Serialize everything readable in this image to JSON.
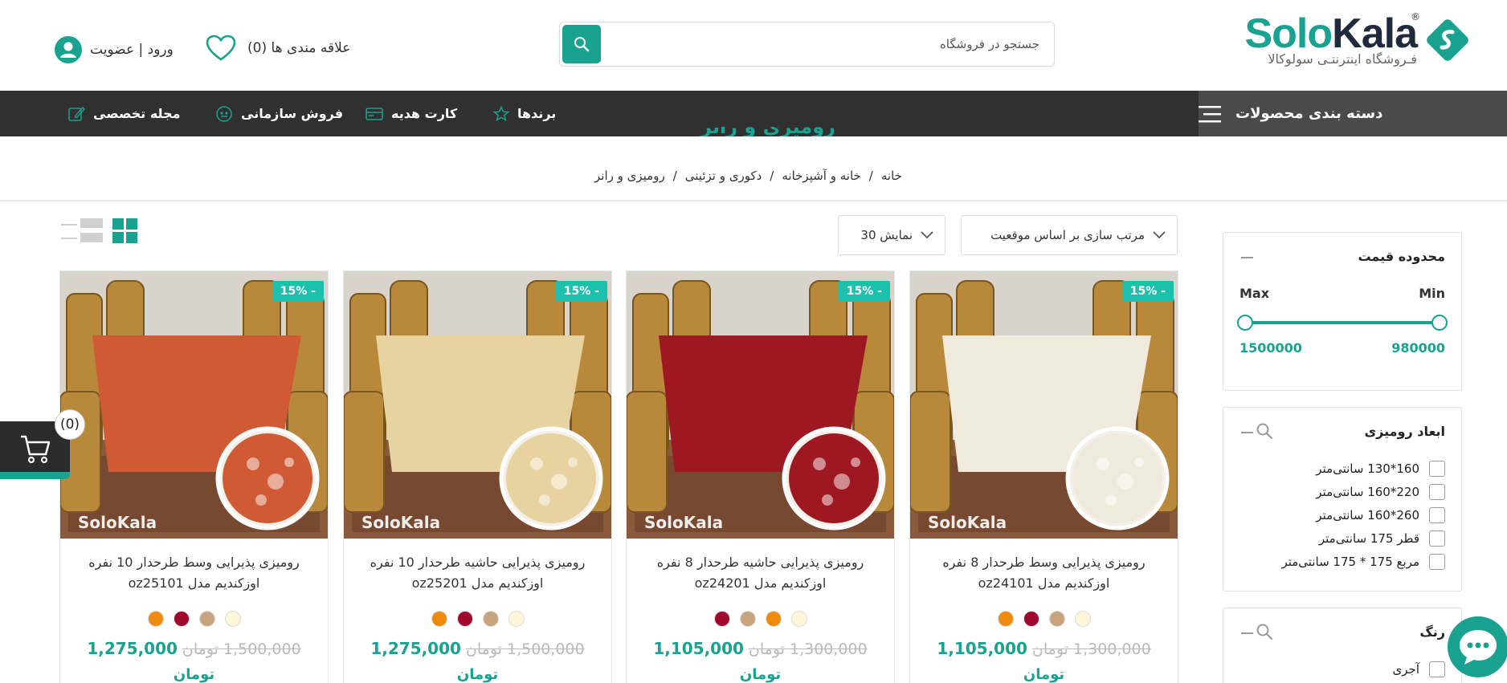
{
  "brand": {
    "name_part1": "Solo",
    "name_part2": "Kala",
    "registered": "®",
    "tagline": "فـروشگاه اینترنتـی سولوکالا"
  },
  "search": {
    "placeholder": "جستجو در فروشگاه"
  },
  "header": {
    "wishlist_label": "علاقه مندی ها (0)",
    "account_label": "ورود | عضویت"
  },
  "nav": {
    "categories": "دسته بندی محصولات",
    "items": [
      "برندها",
      "کارت هدیه",
      "فروش سازمانی",
      "مجله تخصصی"
    ]
  },
  "breadcrumb": [
    "خانه",
    "خانه و آشپزخانه",
    "دکوری و تزئینی",
    "رومیزی و رانر"
  ],
  "breadcrumb_sep": "/",
  "page_title": "رومیزی و رانر",
  "toolbar": {
    "sort_label": "مرتب سازی بر اساس  موقعیت",
    "show_label": "نمایش  30"
  },
  "filters": {
    "price": {
      "title": "محدوده قیمت",
      "min_label": "Min",
      "max_label": "Max",
      "min_value": "980000",
      "max_value": "1500000"
    },
    "size": {
      "title": "ابعاد رومیزی",
      "options": [
        "160*130 سانتی‌متر",
        "220*160 سانتی‌متر",
        "260*160 سانتی‌متر",
        "قطر 175 سانتی‌متر",
        "مربع 175 * 175 سانتی‌متر"
      ]
    },
    "color": {
      "title": "رنگ",
      "options": [
        "آجری"
      ]
    }
  },
  "products": [
    {
      "badge": "15% -",
      "name_line1": "رومیزی پذیرایی وسط طرحدار 8 نفره",
      "name_line2": "اوزکندیم مدل oz24101",
      "price_new": "1,105,000",
      "price_old": "1,300,000 تومان",
      "currency": "تومان",
      "cloth_color": "#efeadb",
      "swatches": [
        "#fdf6d8",
        "#c8a47e",
        "#a0092b",
        "#f08a0c"
      ],
      "watermark": "SoloKala"
    },
    {
      "badge": "15% -",
      "name_line1": "رومیزی پذیرایی حاشیه طرحدار 8 نفره",
      "name_line2": "اوزکندیم مدل oz24201",
      "price_new": "1,105,000",
      "price_old": "1,300,000 تومان",
      "currency": "تومان",
      "cloth_color": "#9e1822",
      "swatches": [
        "#fdf6d8",
        "#f08a0c",
        "#c8a47e",
        "#a0092b"
      ],
      "watermark": "SoloKala"
    },
    {
      "badge": "15% -",
      "name_line1": "رومیزی پذیرایی حاشیه طرحدار 10 نفره",
      "name_line2": "اوزکندیم مدل oz25201",
      "price_new": "1,275,000",
      "price_old": "1,500,000 تومان",
      "currency": "تومان",
      "cloth_color": "#e6d3a0",
      "swatches": [
        "#fdf6d8",
        "#c8a47e",
        "#a0092b",
        "#f08a0c"
      ],
      "watermark": "SoloKala"
    },
    {
      "badge": "15% -",
      "name_line1": "رومیزی پذیرایی وسط طرحدار 10 نفره",
      "name_line2": "اوزکندیم مدل oz25101",
      "price_new": "1,275,000",
      "price_old": "1,500,000 تومان",
      "currency": "تومان",
      "cloth_color": "#cf5a34",
      "swatches": [
        "#fdf6d8",
        "#c8a47e",
        "#a0092b",
        "#f08a0c"
      ],
      "watermark": "SoloKala"
    }
  ],
  "floating_cart": {
    "count": "(0)"
  },
  "colors": {
    "accent": "#1aa291",
    "nav_bg": "#303030",
    "badge": "#1dc0ad"
  }
}
